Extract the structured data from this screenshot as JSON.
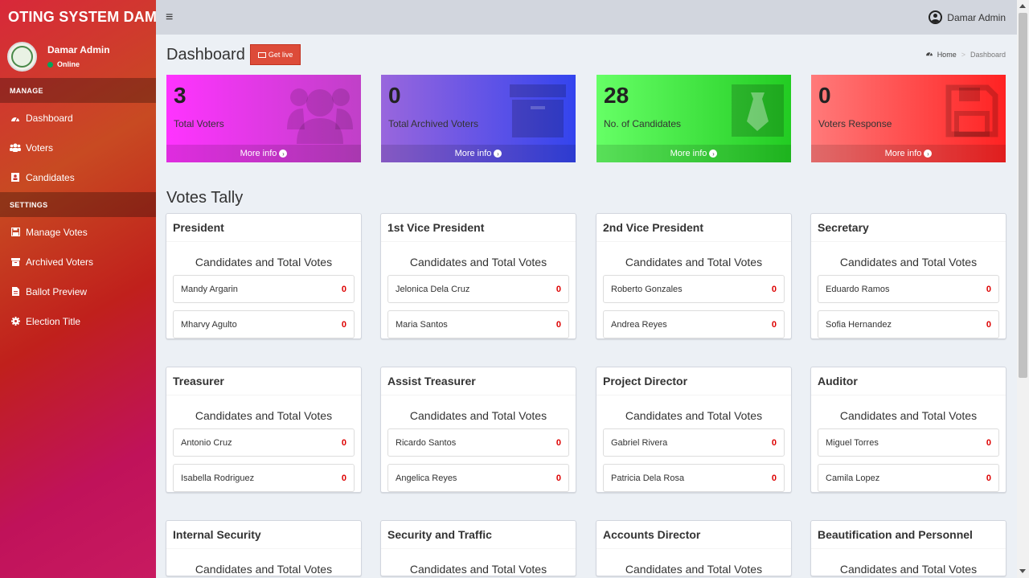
{
  "sidebar": {
    "brand": "OTING SYSTEM DAMA",
    "user_name": "Damar Admin",
    "user_status": "Online",
    "manage_header": "MANAGE",
    "settings_header": "SETTINGS",
    "items": [
      {
        "label": "Dashboard",
        "icon": "dashboard-icon"
      },
      {
        "label": "Voters",
        "icon": "users-icon"
      },
      {
        "label": "Candidates",
        "icon": "candidates-icon"
      },
      {
        "label": "Manage Votes",
        "icon": "save-icon"
      },
      {
        "label": "Archived Voters",
        "icon": "archive-icon"
      },
      {
        "label": "Ballot Preview",
        "icon": "file-icon"
      },
      {
        "label": "Election Title",
        "icon": "gear-icon"
      }
    ]
  },
  "topbar": {
    "menu_icon": "≡",
    "user_name": "Damar Admin"
  },
  "header": {
    "title": "Dashboard",
    "get_live": "Get live",
    "breadcrumb_home": "Home",
    "breadcrumb_current": "Dashboard"
  },
  "stats": [
    {
      "value": "3",
      "label": "Total Voters",
      "more": "More info",
      "color_from": "#ff33ff",
      "color_to": "#c040c8"
    },
    {
      "value": "0",
      "label": "Total Archived Voters",
      "more": "More info",
      "color_from": "#9966dd",
      "color_to": "#3344ee"
    },
    {
      "value": "28",
      "label": "No. of Candidates",
      "more": "More info",
      "color_from": "#66ff66",
      "color_to": "#22cc22"
    },
    {
      "value": "0",
      "label": "Voters Response",
      "more": "More info",
      "color_from": "#ff7a7a",
      "color_to": "#ff2222"
    }
  ],
  "tally": {
    "title": "Votes Tally",
    "subtitle": "Candidates and Total Votes",
    "positions": [
      {
        "name": "President",
        "candidates": [
          {
            "name": "Mandy Argarin",
            "votes": "0"
          },
          {
            "name": "Mharvy Agulto",
            "votes": "0"
          }
        ]
      },
      {
        "name": "1st Vice President",
        "candidates": [
          {
            "name": "Jelonica Dela Cruz",
            "votes": "0"
          },
          {
            "name": "Maria Santos",
            "votes": "0"
          }
        ]
      },
      {
        "name": "2nd Vice President",
        "candidates": [
          {
            "name": "Roberto Gonzales",
            "votes": "0"
          },
          {
            "name": "Andrea Reyes",
            "votes": "0"
          }
        ]
      },
      {
        "name": "Secretary",
        "candidates": [
          {
            "name": "Eduardo Ramos",
            "votes": "0"
          },
          {
            "name": "Sofia Hernandez",
            "votes": "0"
          }
        ]
      },
      {
        "name": "Treasurer",
        "candidates": [
          {
            "name": "Antonio Cruz",
            "votes": "0"
          },
          {
            "name": "Isabella Rodriguez",
            "votes": "0"
          }
        ]
      },
      {
        "name": "Assist Treasurer",
        "candidates": [
          {
            "name": "Ricardo Santos",
            "votes": "0"
          },
          {
            "name": "Angelica Reyes",
            "votes": "0"
          }
        ]
      },
      {
        "name": "Project Director",
        "candidates": [
          {
            "name": "Gabriel Rivera",
            "votes": "0"
          },
          {
            "name": "Patricia Dela Rosa",
            "votes": "0"
          }
        ]
      },
      {
        "name": "Auditor",
        "candidates": [
          {
            "name": "Miguel Torres",
            "votes": "0"
          },
          {
            "name": "Camila Lopez",
            "votes": "0"
          }
        ]
      },
      {
        "name": "Internal Security",
        "candidates": []
      },
      {
        "name": "Security and Traffic",
        "candidates": []
      },
      {
        "name": "Accounts Director",
        "candidates": []
      },
      {
        "name": "Beautification and Personnel",
        "candidates": []
      }
    ]
  }
}
